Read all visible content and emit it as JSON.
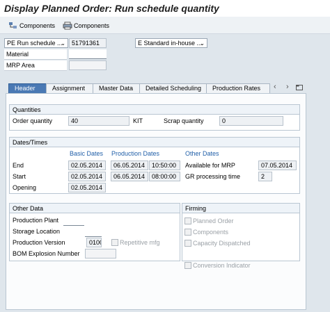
{
  "title": "Display Planned Order: Run schedule quantity",
  "toolbar": {
    "btn1_label": "Components",
    "btn2_label": "Components"
  },
  "header": {
    "order_type": "PE Run schedule ...",
    "order_number": "51791361",
    "procurement": "E Standard in-house ...",
    "material_label": "Material",
    "material_value": "",
    "mrp_area_label": "MRP Area",
    "mrp_area_value": ""
  },
  "tabs": [
    "Header",
    "Assignment",
    "Master Data",
    "Detailed Scheduling",
    "Production Rates"
  ],
  "quantities": {
    "title": "Quantities",
    "order_qty_label": "Order quantity",
    "order_qty_value": "40",
    "unit": "KIT",
    "scrap_label": "Scrap quantity",
    "scrap_value": "0"
  },
  "dates": {
    "title": "Dates/Times",
    "basic_dates": "Basic Dates",
    "production_dates": "Production Dates",
    "other_dates": "Other Dates",
    "end_label": "End",
    "end_basic": "02.05.2014",
    "end_prod_date": "06.05.2014",
    "end_prod_time": "10:50:00",
    "start_label": "Start",
    "start_basic": "02.05.2014",
    "start_prod_date": "06.05.2014",
    "start_prod_time": "08:00:00",
    "opening_label": "Opening",
    "opening_basic": "02.05.2014",
    "available_label": "Available for MRP",
    "available_value": "07.05.2014",
    "gr_label": "GR processing time",
    "gr_value": "2"
  },
  "other_data": {
    "title": "Other Data",
    "prod_plant_label": "Production Plant",
    "prod_plant_value": "",
    "storage_label": "Storage Location",
    "storage_value": "",
    "prod_version_label": "Production Version",
    "prod_version_value": "0100",
    "repetitive_label": "Repetitive mfg",
    "bom_label": "BOM Explosion Number",
    "bom_value": ""
  },
  "firming": {
    "title": "Firming",
    "planned_order": "Planned Order",
    "components": "Components",
    "capacity": "Capacity Dispatched",
    "conversion": "Conversion Indicator"
  }
}
